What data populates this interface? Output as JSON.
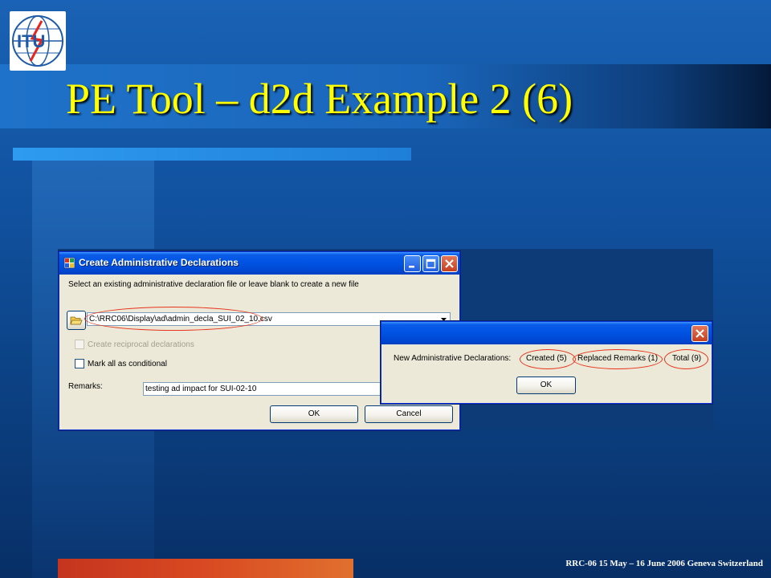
{
  "slide": {
    "title": "PE Tool – d2d Example 2 (6)",
    "footer": "RRC-06 15 May – 16 June 2006 Geneva Switzerland",
    "logo_text": "ITU"
  },
  "create_dialog": {
    "title": "Create Administrative Declarations",
    "instruction": "Select an existing administrative declaration file or leave blank to create a new file",
    "file_path": "C:\\RRC06\\Display\\ad\\admin_decla_SUI_02_10.csv",
    "reciprocal_label": "Create reciprocal declarations",
    "conditional_label": "Mark all as conditional",
    "remarks_label": "Remarks:",
    "remarks_value": "testing ad impact for SUI-02-10",
    "ok_label": "OK",
    "cancel_label": "Cancel"
  },
  "result_dialog": {
    "summary_label": "New Administrative Declarations:",
    "created": "Created (5)",
    "replaced": "Replaced Remarks (1)",
    "total": "Total (9)",
    "ok_label": "OK"
  },
  "colors": {
    "title_text": "#ffff00",
    "highlight_oval": "#e8341c",
    "xp_titlebar": "#0054e3"
  }
}
